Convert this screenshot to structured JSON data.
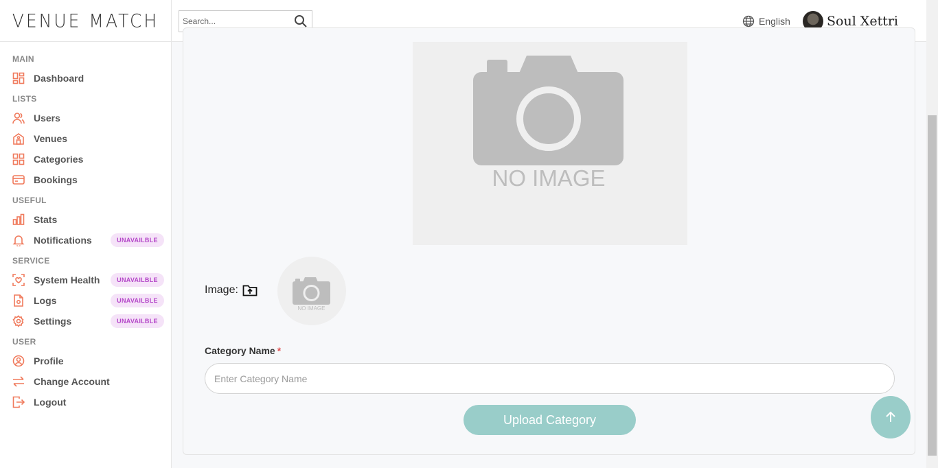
{
  "app": {
    "logo_text": "VENUE MATCH"
  },
  "header": {
    "search_placeholder": "Search...",
    "language": "English",
    "user_name": "Soul Xettri"
  },
  "sidebar": {
    "sections": [
      {
        "title": "MAIN",
        "items": [
          {
            "label": "Dashboard",
            "icon": "dashboard-icon"
          }
        ]
      },
      {
        "title": "LISTS",
        "items": [
          {
            "label": "Users",
            "icon": "users-icon"
          },
          {
            "label": "Venues",
            "icon": "venue-icon"
          },
          {
            "label": "Categories",
            "icon": "categories-icon"
          },
          {
            "label": "Bookings",
            "icon": "bookings-icon"
          }
        ]
      },
      {
        "title": "USEFUL",
        "items": [
          {
            "label": "Stats",
            "icon": "stats-icon"
          },
          {
            "label": "Notifications",
            "icon": "bell-icon",
            "badge": "UNAVAILBLE"
          }
        ]
      },
      {
        "title": "SERVICE",
        "items": [
          {
            "label": "System Health",
            "icon": "health-icon",
            "badge": "UNAVAILBLE"
          },
          {
            "label": "Logs",
            "icon": "logs-icon",
            "badge": "UNAVAILBLE"
          },
          {
            "label": "Settings",
            "icon": "gear-icon",
            "badge": "UNAVAILBLE"
          }
        ]
      },
      {
        "title": "USER",
        "items": [
          {
            "label": "Profile",
            "icon": "profile-icon"
          },
          {
            "label": "Change Account",
            "icon": "swap-icon"
          },
          {
            "label": "Logout",
            "icon": "logout-icon"
          }
        ]
      }
    ]
  },
  "form": {
    "preview_text": "NO IMAGE",
    "image_label": "Image:",
    "category_name_label": "Category Name",
    "required_mark": "*",
    "category_name_placeholder": "Enter Category Name",
    "category_name_value": "",
    "upload_button": "Upload Category"
  },
  "colors": {
    "accent": "#f07a5c",
    "button": "#99cdc9",
    "badge_bg": "#f5e3f8",
    "badge_text": "#b446c8"
  }
}
